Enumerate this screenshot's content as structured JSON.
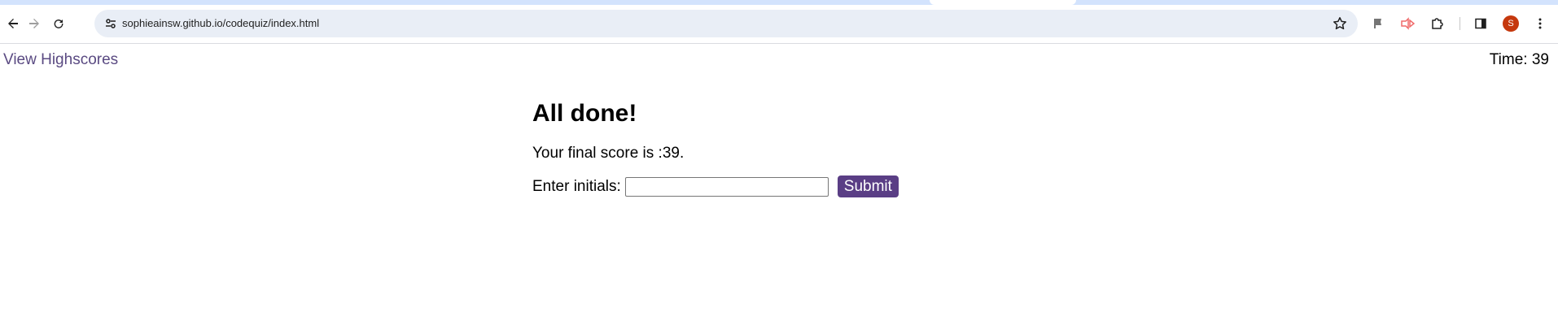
{
  "browser": {
    "url": "sophieainsw.github.io/codequiz/index.html",
    "avatar_letter": "S",
    "icons": {
      "back": "back-arrow-icon",
      "forward": "forward-arrow-icon",
      "reload": "reload-icon",
      "site_info": "tune-icon",
      "bookmark": "star-icon",
      "extension1": "flag-extension-icon",
      "extension2": "video-extension-icon",
      "extensions": "puzzle-icon",
      "side_panel": "side-panel-icon",
      "menu": "kebab-menu-icon"
    },
    "colors": {
      "tab_strip": "#d3e3fd",
      "omnibox": "#e9eef6",
      "avatar": "#c5380d",
      "extension2": "#f06a6a"
    }
  },
  "header": {
    "highscores_link": "View Highscores",
    "timer_label": "Time: ",
    "timer_value": "39"
  },
  "quiz": {
    "title": "All done!",
    "score_text": "Your final score is :39.",
    "initials_label": "Enter initials:",
    "initials_value": "",
    "submit_label": "Submit"
  },
  "colors": {
    "link": "#5a4a82",
    "button": "#5a3e85"
  }
}
